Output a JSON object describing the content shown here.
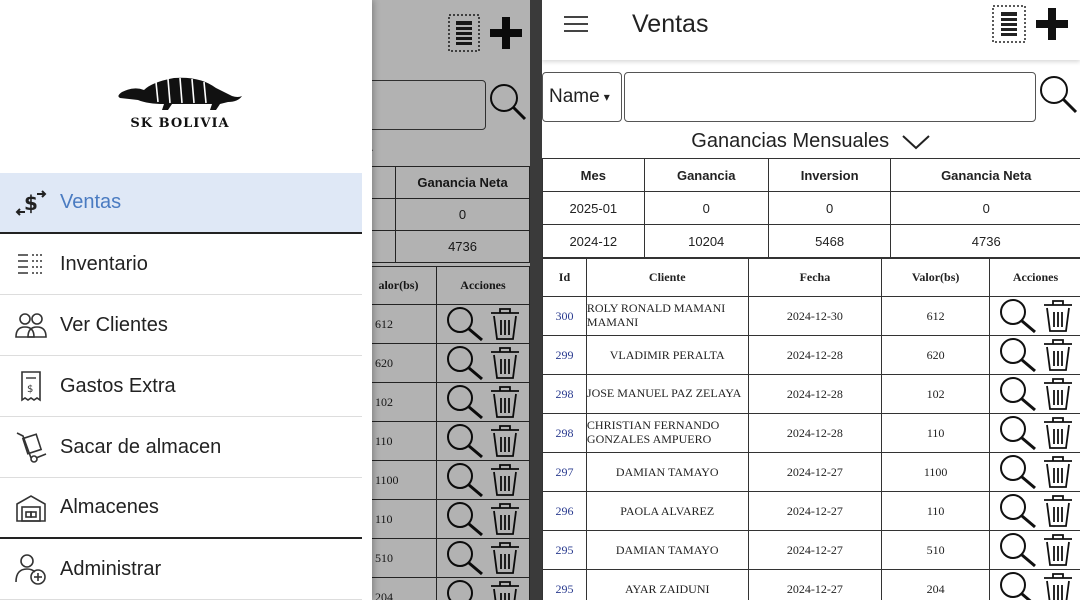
{
  "drawer": {
    "brand": "SK BOLIVIA",
    "items": [
      {
        "label": "Ventas",
        "icon": "sales-exchange-icon",
        "active": true
      },
      {
        "label": "Inventario",
        "icon": "inventory-list-icon"
      },
      {
        "label": "Ver Clientes",
        "icon": "clients-icon"
      },
      {
        "label": "Gastos Extra",
        "icon": "receipt-icon"
      },
      {
        "label": "Sacar de almacen",
        "icon": "hand-truck-icon"
      },
      {
        "label": "Almacenes",
        "icon": "warehouse-icon"
      },
      {
        "label": "Administrar",
        "icon": "user-add-icon"
      }
    ]
  },
  "behind": {
    "summary_header": "Ganancia Neta",
    "summary_values": [
      "0",
      "4736"
    ],
    "list_headers": [
      "alor(bs)",
      "Acciones"
    ],
    "list_values": [
      "612",
      "620",
      "102",
      "110",
      "1100",
      "110",
      "510",
      "204"
    ]
  },
  "app": {
    "title": "Ventas",
    "filter": {
      "selected": "Name",
      "placeholder": ""
    },
    "summary_title": "Ganancias Mensuales",
    "summary": {
      "headers": [
        "Mes",
        "Ganancia",
        "Inversion",
        "Ganancia Neta"
      ],
      "rows": [
        [
          "2025-01",
          "0",
          "0",
          "0"
        ],
        [
          "2024-12",
          "10204",
          "5468",
          "4736"
        ]
      ]
    },
    "ventas": {
      "headers": [
        "Id",
        "Cliente",
        "Fecha",
        "Valor(bs)",
        "Acciones"
      ],
      "rows": [
        {
          "id": "300",
          "cliente": "ROLY RONALD MAMANI MAMANI",
          "fecha": "2024-12-30",
          "valor": "612"
        },
        {
          "id": "299",
          "cliente": "VLADIMIR PERALTA",
          "fecha": "2024-12-28",
          "valor": "620"
        },
        {
          "id": "298",
          "cliente": "JOSE MANUEL PAZ ZELAYA",
          "fecha": "2024-12-28",
          "valor": "102"
        },
        {
          "id": "298",
          "cliente": "CHRISTIAN FERNANDO GONZALES AMPUERO",
          "fecha": "2024-12-28",
          "valor": "110"
        },
        {
          "id": "297",
          "cliente": "DAMIAN TAMAYO",
          "fecha": "2024-12-27",
          "valor": "1100"
        },
        {
          "id": "296",
          "cliente": "PAOLA ALVAREZ",
          "fecha": "2024-12-27",
          "valor": "110"
        },
        {
          "id": "295",
          "cliente": "DAMIAN TAMAYO",
          "fecha": "2024-12-27",
          "valor": "510"
        },
        {
          "id": "295",
          "cliente": "AYAR ZAIDUNI",
          "fecha": "2024-12-27",
          "valor": "204"
        }
      ]
    }
  },
  "colors": {
    "active_bg": "#dfe8f6",
    "active_text": "#4a7bc1",
    "id_link": "#2a3b8f",
    "divider": "#3a3a3a"
  }
}
